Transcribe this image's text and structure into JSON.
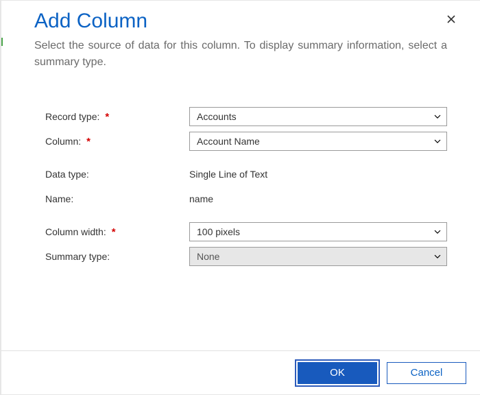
{
  "dialog": {
    "title": "Add Column",
    "subtitle": "Select the source of data for this column. To display summary information, select a summary type."
  },
  "fields": {
    "record_type": {
      "label": "Record type:",
      "value": "Accounts",
      "required": true
    },
    "column": {
      "label": "Column:",
      "value": "Account Name",
      "required": true
    },
    "data_type": {
      "label": "Data type:",
      "value": "Single Line of Text"
    },
    "name": {
      "label": "Name:",
      "value": "name"
    },
    "column_width": {
      "label": "Column width:",
      "value": "100 pixels",
      "required": true
    },
    "summary_type": {
      "label": "Summary type:",
      "value": "None"
    }
  },
  "buttons": {
    "ok": "OK",
    "cancel": "Cancel"
  },
  "required_marker": "*"
}
